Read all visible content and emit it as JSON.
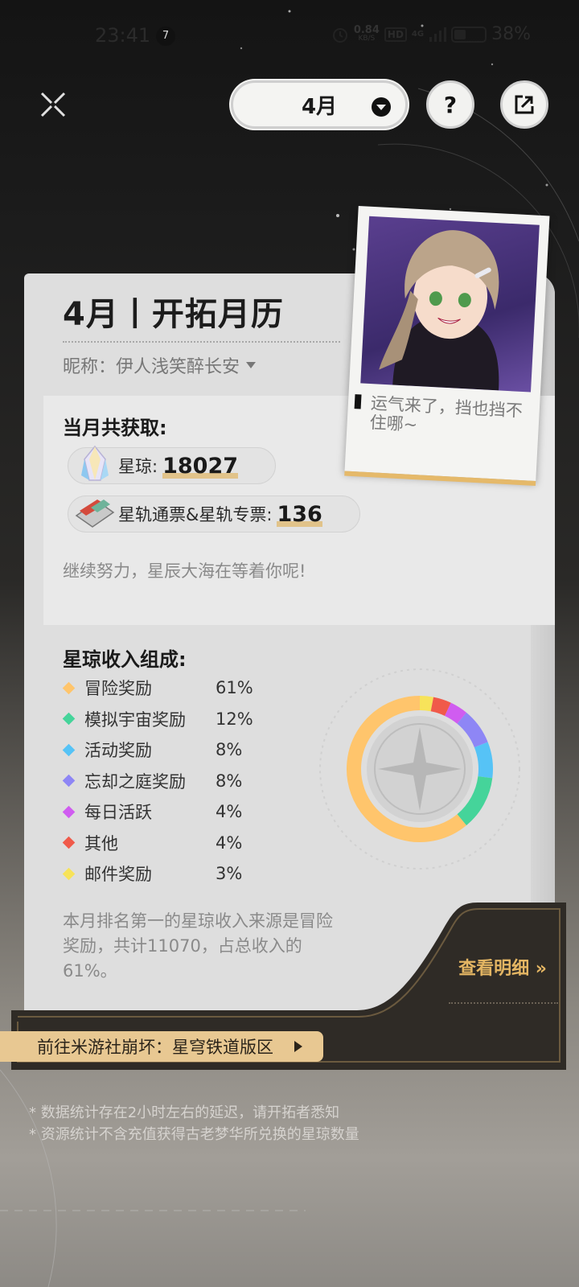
{
  "status_bar": {
    "time": "23:41",
    "notification_count": "7",
    "net_speed": "0.84",
    "net_unit": "KB/S",
    "hd": "HD",
    "signal": "4G",
    "battery": "38%"
  },
  "header": {
    "month": "4月",
    "help": "?"
  },
  "card": {
    "title": "4月丨开拓月历",
    "nickname": "昵称：伊人浅笑醉长安"
  },
  "polaroid": {
    "quote": "运气来了，挡也挡不住哪~"
  },
  "gain": {
    "title": "当月共获取:",
    "stellar_jade_label": "星琼:",
    "stellar_jade_value": "18027",
    "pass_label": "星轨通票&星轨专票:",
    "pass_value": "136",
    "encourage": "继续努力，星辰大海在等着你呢!"
  },
  "composition": {
    "title": "星琼收入组成:",
    "items": [
      {
        "label": "冒险奖励",
        "pct": "61%",
        "value": 61,
        "color": "#ffc56c"
      },
      {
        "label": "模拟宇宙奖励",
        "pct": "12%",
        "value": 12,
        "color": "#45d49a"
      },
      {
        "label": "活动奖励",
        "pct": "8%",
        "value": 8,
        "color": "#56c3f6"
      },
      {
        "label": "忘却之庭奖励",
        "pct": "8%",
        "value": 8,
        "color": "#8e86f5"
      },
      {
        "label": "每日活跃",
        "pct": "4%",
        "value": 4,
        "color": "#d05cf0"
      },
      {
        "label": "其他",
        "pct": "4%",
        "value": 4,
        "color": "#f05a4a"
      },
      {
        "label": "邮件奖励",
        "pct": "3%",
        "value": 3,
        "color": "#f7e35a"
      }
    ],
    "summary": "本月排名第一的星琼收入来源是冒险奖励，共计11070，占总收入的61%。"
  },
  "actions": {
    "detail": "查看明细 »",
    "forum": "前往米游社崩坏：星穹铁道版区"
  },
  "notes": {
    "line1": "* 数据统计存在2小时左右的延迟，请开拓者悉知",
    "line2": "* 资源统计不含充值获得古老梦华所兑换的星琼数量"
  }
}
